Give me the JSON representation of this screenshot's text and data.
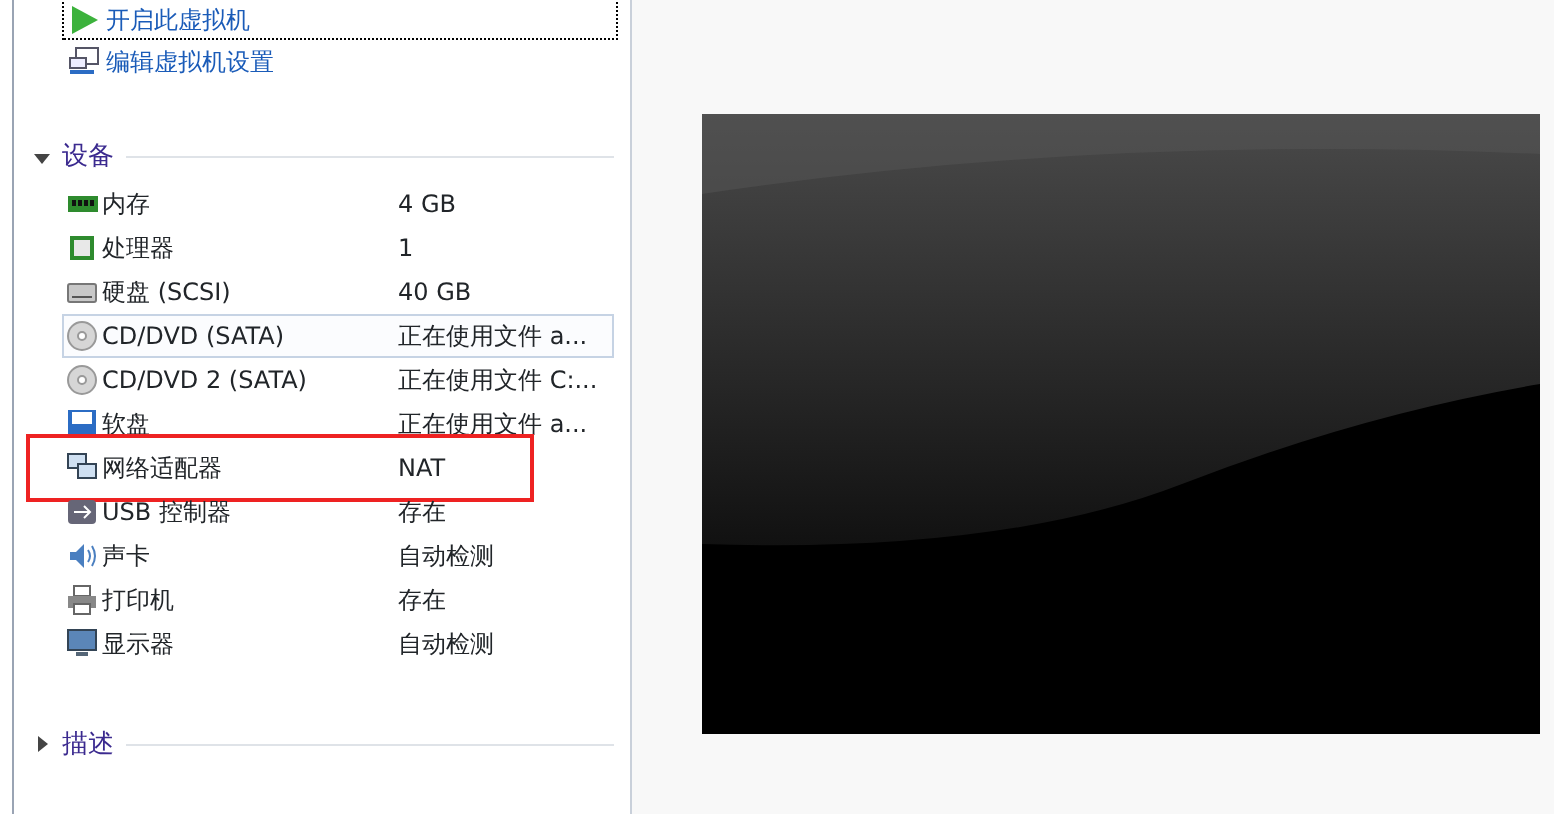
{
  "actions": [
    {
      "label": "开启此虚拟机",
      "kind": "play",
      "focused": true
    },
    {
      "label": "编辑虚拟机设置",
      "kind": "settings",
      "focused": false
    }
  ],
  "sections": [
    {
      "title": "设备",
      "expanded": true,
      "devices": [
        {
          "name": "内存",
          "value": "4 GB",
          "kind": "memory",
          "selected": false,
          "highlighted": false
        },
        {
          "name": "处理器",
          "value": "1",
          "kind": "cpu",
          "selected": false,
          "highlighted": false
        },
        {
          "name": "硬盘 (SCSI)",
          "value": "40 GB",
          "kind": "disk",
          "selected": false,
          "highlighted": false
        },
        {
          "name": "CD/DVD (SATA)",
          "value": "正在使用文件 a...",
          "kind": "cd",
          "selected": true,
          "highlighted": false
        },
        {
          "name": "CD/DVD 2 (SATA)",
          "value": "正在使用文件 C:...",
          "kind": "cd",
          "selected": false,
          "highlighted": false
        },
        {
          "name": "软盘",
          "value": "正在使用文件 a...",
          "kind": "floppy",
          "selected": false,
          "highlighted": false
        },
        {
          "name": "网络适配器",
          "value": "NAT",
          "kind": "network",
          "selected": false,
          "highlighted": true
        },
        {
          "name": "USB 控制器",
          "value": "存在",
          "kind": "usb",
          "selected": false,
          "highlighted": false
        },
        {
          "name": "声卡",
          "value": "自动检测",
          "kind": "sound",
          "selected": false,
          "highlighted": false
        },
        {
          "name": "打印机",
          "value": "存在",
          "kind": "printer",
          "selected": false,
          "highlighted": false
        },
        {
          "name": "显示器",
          "value": "自动检测",
          "kind": "display",
          "selected": false,
          "highlighted": false
        }
      ]
    },
    {
      "title": "描述",
      "expanded": false
    }
  ]
}
